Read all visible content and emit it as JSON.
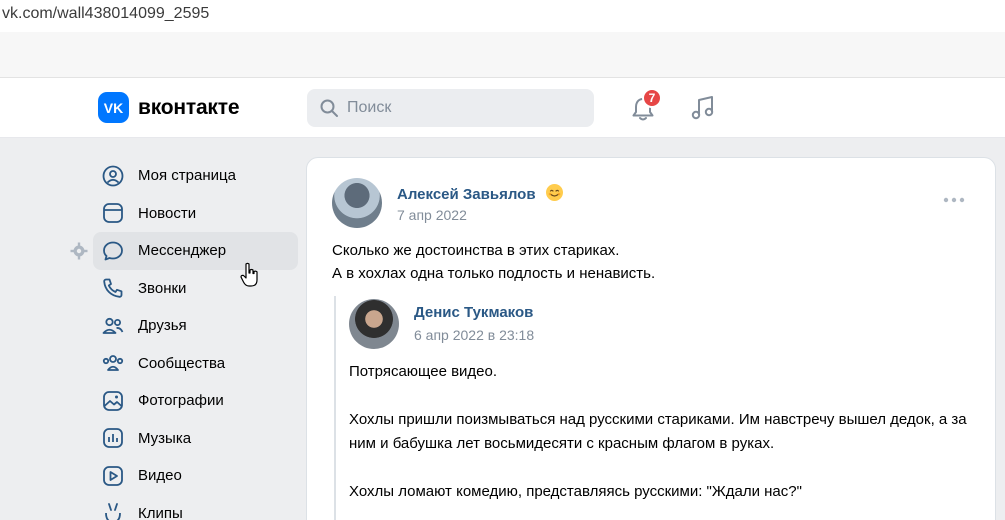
{
  "browser": {
    "url": "vk.com/wall438014099_2595"
  },
  "header": {
    "logo_mark": "VK",
    "logo_text": "вконтакте",
    "search_placeholder": "Поиск",
    "notifications_count": "7",
    "brand_color": "#0077ff",
    "badge_color": "#e64646"
  },
  "sidebar": {
    "items": [
      {
        "label": "Моя страница",
        "icon": "profile-icon"
      },
      {
        "label": "Новости",
        "icon": "news-icon"
      },
      {
        "label": "Мессенджер",
        "icon": "messenger-icon",
        "active": true
      },
      {
        "label": "Звонки",
        "icon": "phone-icon"
      },
      {
        "label": "Друзья",
        "icon": "friends-icon"
      },
      {
        "label": "Сообщества",
        "icon": "communities-icon"
      },
      {
        "label": "Фотографии",
        "icon": "photos-icon"
      },
      {
        "label": "Музыка",
        "icon": "music-icon"
      },
      {
        "label": "Видео",
        "icon": "video-icon"
      },
      {
        "label": "Клипы",
        "icon": "clips-icon"
      }
    ]
  },
  "post": {
    "author": "Алексей Завьялов",
    "date": "7 апр 2022",
    "text_lines": [
      "Сколько же достоинства в этих стариках.",
      "А в хохлах одна только подлость и ненависть."
    ],
    "repost": {
      "author": "Денис Тукмаков",
      "date": "6 апр 2022 в 23:18",
      "paragraphs": [
        "Потрясающее видео.",
        "Хохлы пришли поизмываться над русскими стариками. Им навстречу вышел дедок, а за ним и бабушка лет восьмидесяти с красным флагом в руках.",
        "Хохлы ломают комедию, представляясь русскими: \"Ждали нас?\""
      ]
    }
  }
}
